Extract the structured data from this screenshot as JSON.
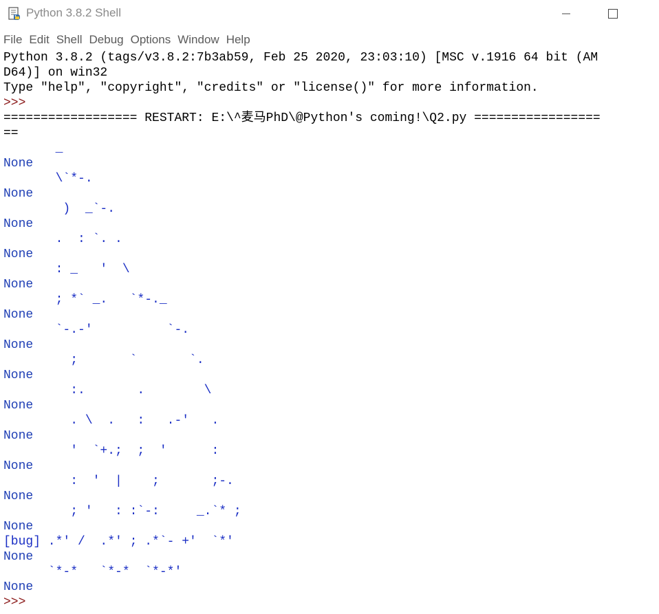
{
  "window": {
    "title": "Python 3.8.2 Shell"
  },
  "menu": [
    "File",
    "Edit",
    "Shell",
    "Debug",
    "Options",
    "Window",
    "Help"
  ],
  "shell": {
    "banner_1": "Python 3.8.2 (tags/v3.8.2:7b3ab59, Feb 25 2020, 23:03:10) [MSC v.1916 64 bit (AM",
    "banner_2": "D64)] on win32",
    "banner_3": "Type \"help\", \"copyright\", \"credits\" or \"license()\" for more information.",
    "prompt_1": ">>>",
    "restart_1": "================== RESTART: E:\\^麦马PhD\\@Python's coming!\\Q2.py =================",
    "restart_2": "==",
    "art": [
      "       _",
      "       \\`*-.",
      "        )  _`-.",
      "       .  : `. .",
      "       : _   '  \\",
      "       ; *` _.   `*-._",
      "       `-.-'          `-.",
      "         ;       `       `.",
      "         :.       .        \\",
      "         . \\  .   :   .-'   .",
      "         '  `+.;  ;  '      :",
      "         :  '  |    ;       ;-.",
      "         ; '   : :`-:     _.`* ;"
    ],
    "none_label": "None",
    "bug_line": "[bug] .*' /  .*' ; .*`- +'  `*'",
    "bottom_art": "      `*-*   `*-*  `*-*'",
    "prompt_2": ">>>"
  }
}
